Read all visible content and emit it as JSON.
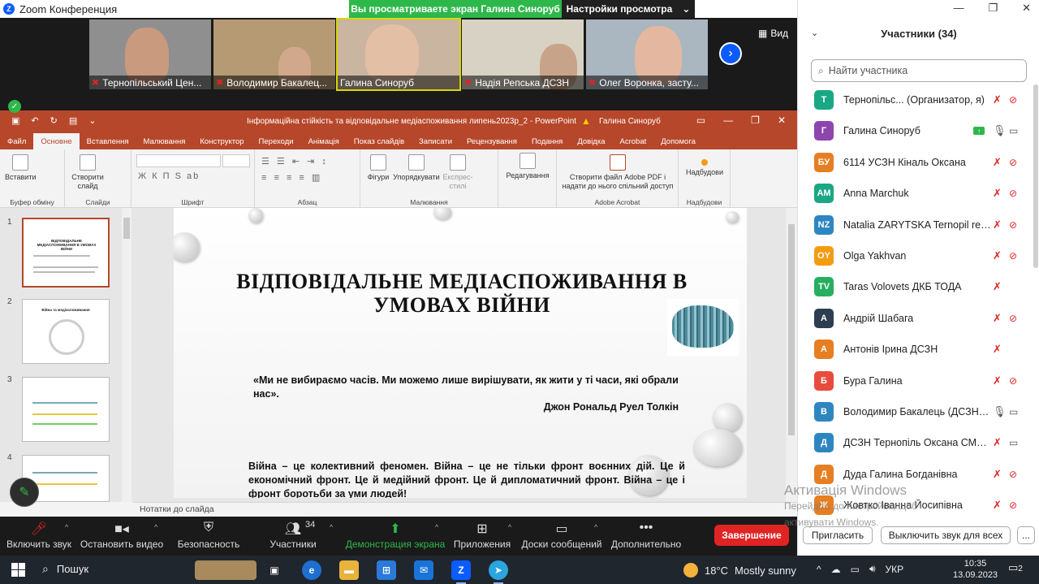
{
  "zoom": {
    "window_title": "Zoom Конференция",
    "share_banner": "Вы просматриваете экран Галина Синоруб",
    "view_options": "Настройки просмотра",
    "view_label": "Вид"
  },
  "video_tiles": [
    {
      "name": "Тернопільський Цен..."
    },
    {
      "name": "Володимир Бакалец..."
    },
    {
      "name": "Галина Синоруб"
    },
    {
      "name": "Надія Репська ДСЗН"
    },
    {
      "name": "Олег Воронка, засту..."
    }
  ],
  "ppt": {
    "doc_title": "Інформаційна стійкість та відповідальне медіаспоживання липень2023р_2  -  PowerPoint",
    "user": "Галина Синоруб",
    "tabs": [
      "Файл",
      "Основне",
      "Вставлення",
      "Малювання",
      "Конструктор",
      "Переходи",
      "Анімація",
      "Показ слайдів",
      "Записати",
      "Рецензування",
      "Подання",
      "Довідка",
      "Acrobat",
      "Допомога"
    ],
    "ribbon": {
      "paste": "Вставити",
      "clipboard": "Буфер обміну",
      "new_slide": "Створити слайд",
      "slides": "Слайди",
      "font": "Шрифт",
      "paragraph": "Абзац",
      "shapes": "Фігури",
      "arrange": "Упорядкувати",
      "quick_styles": "Експрес-стилі",
      "drawing": "Малювання",
      "editing": "Редагування",
      "adobe_create": "Створити файл Adobe PDF і надати до нього спільний доступ",
      "adobe_group": "Adobe Acrobat",
      "addins": "Надбудови",
      "addins_group": "Надбудови",
      "font_tools": "Ж  К  П  S  ab"
    },
    "thumbnails": [
      {
        "num": "1",
        "title": "ВІДПОВІДАЛЬНЕ МЕДІАСПОЖИВАННЯ В УМОВАХ ВІЙНИ"
      },
      {
        "num": "2",
        "title": "Війна та медіаспоживання"
      },
      {
        "num": "3",
        "title": ""
      },
      {
        "num": "4",
        "title": ""
      }
    ],
    "notes_placeholder": "Нотатки до слайда"
  },
  "slide": {
    "title": "ВІДПОВІДАЛЬНЕ МЕДІАСПОЖИВАННЯ В УМОВАХ ВІЙНИ",
    "quote": "«Ми не вибираємо часів. Ми можемо лише вирішувати, як жити у ті часи, які обрали нас».",
    "author": "Джон Рональд Руел Толкін",
    "body": "Війна – це колективний феномен. Війна – це не тільки фронт воєнних дій. Це й економічний фронт. Це й медійний фронт. Це й дипломатичний фронт. Війна – це і фронт боротьби за уми людей!"
  },
  "toolbar": {
    "unmute": "Включить звук",
    "video": "Остановить видео",
    "security": "Безопасность",
    "participants": "Участники",
    "participants_count": "34",
    "share": "Демонстрация экрана",
    "apps": "Приложения",
    "whiteboard": "Доски сообщений",
    "more": "Дополнительно",
    "end": "Завершение"
  },
  "panel": {
    "title": "Участники (34)",
    "search_placeholder": "Найти участника",
    "participants": [
      {
        "initials": "T",
        "color": "#1aa784",
        "name": "Тернопільс... (Организатор, я)",
        "mic": "muted",
        "cam": "off"
      },
      {
        "initials": "Г",
        "color": "#8e44ad",
        "name": "Галина Синоруб",
        "mic": "on",
        "cam": "on",
        "sharing": true
      },
      {
        "initials": "БУ",
        "color": "#e67e22",
        "name": "6114 УСЗН Кіналь Оксана",
        "mic": "muted",
        "cam": "off"
      },
      {
        "initials": "AM",
        "color": "#1aa784",
        "name": "Anna Marchuk",
        "mic": "muted",
        "cam": "off"
      },
      {
        "initials": "NZ",
        "color": "#2e86c1",
        "name": "Natalia ZARYTSKA Ternopil reg...",
        "mic": "muted",
        "cam": "off"
      },
      {
        "initials": "OY",
        "color": "#f39c12",
        "name": "Olga Yakhvan",
        "mic": "muted",
        "cam": "off"
      },
      {
        "initials": "TV",
        "color": "#27ae60",
        "name": "Taras Volovets ДКБ ТОДА",
        "mic": "muted",
        "cam": ""
      },
      {
        "initials": "А",
        "color": "#2c3e50",
        "name": "Андрій Шабага",
        "mic": "muted",
        "cam": "off"
      },
      {
        "initials": "А",
        "color": "#e67e22",
        "name": "Антонів Ірина ДСЗН",
        "mic": "muted",
        "cam": ""
      },
      {
        "initials": "Б",
        "color": "#e74c3c",
        "name": "Бура Галина",
        "mic": "muted",
        "cam": "off"
      },
      {
        "initials": "В",
        "color": "#2e86c1",
        "name": "Володимир Бакалець (ДСЗН Т...",
        "mic": "on",
        "cam": "on"
      },
      {
        "initials": "Д",
        "color": "#2e86c1",
        "name": "ДСЗН Тернопіль Оксана СМО...",
        "mic": "muted",
        "cam": "on"
      },
      {
        "initials": "Д",
        "color": "#e67e22",
        "name": "Дуда Галина Богданівна",
        "mic": "muted",
        "cam": "off"
      },
      {
        "initials": "Ж",
        "color": "#e67e22",
        "name": "Жовтко Іванна Йосипівна",
        "mic": "muted",
        "cam": "off"
      }
    ],
    "invite": "Пригласить",
    "mute_all": "Выключить звук для всех",
    "more": "..."
  },
  "watermark": {
    "line1": "Активація Windows",
    "line2": "Перейдіть до настройок, щоб",
    "line3": "активувати Windows."
  },
  "taskbar": {
    "search": "Пошук",
    "weather_temp": "18°C",
    "weather_desc": "Mostly sunny",
    "lang": "УКР",
    "time": "10:35",
    "date": "13.09.2023",
    "notifications": "2"
  }
}
